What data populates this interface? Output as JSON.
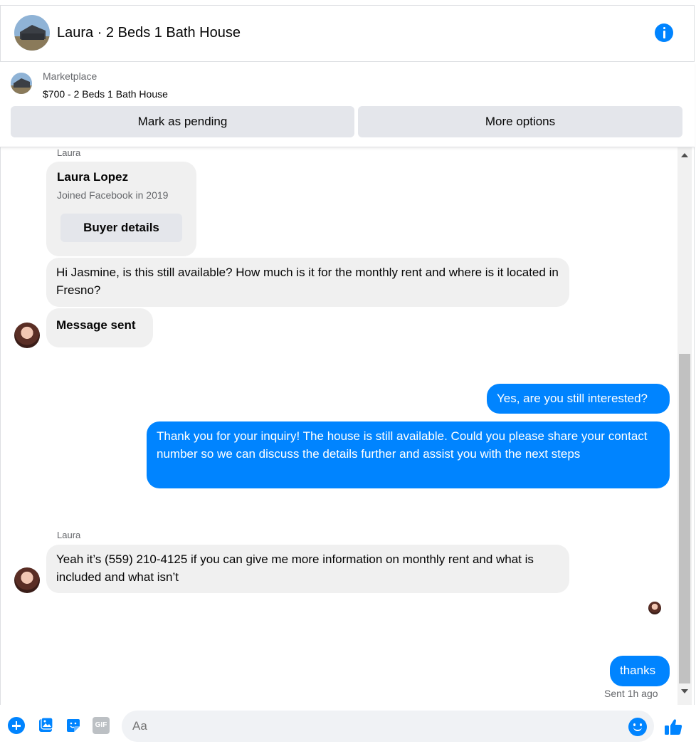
{
  "header": {
    "title": "Laura · 2 Beds 1 Bath House"
  },
  "marketplace": {
    "label": "Marketplace",
    "item": "$700 - 2 Beds 1 Bath House",
    "mark_pending_label": "Mark as pending",
    "more_options_label": "More options"
  },
  "chat": {
    "sender_name_1": "Laura",
    "profile_card": {
      "name": "Laura Lopez",
      "joined": "Joined Facebook in 2019",
      "button_label": "Buyer details"
    },
    "msg_in_1": "Hi Jasmine, is this still available? How much is it for the monthly rent and where is it located in Fresno?",
    "msg_in_2": "Message sent",
    "msg_out_1": "Yes, are you still interested?",
    "msg_out_2": "Thank you for your inquiry! The house is still available. Could you please share your contact number so we can discuss the details further and assist you with the next steps",
    "sender_name_2": "Laura",
    "msg_in_3": "Yeah it’s (559) 210-4125 if you can give me more information on monthly rent and what is included and what isn’t",
    "msg_out_3": "thanks",
    "sent_status": "Sent 1h ago"
  },
  "composer": {
    "placeholder": "Aa",
    "gif_label": "GIF"
  },
  "colors": {
    "accent": "#0084ff",
    "incoming_bubble": "#f0f0f0",
    "button_bg": "#e4e6eb"
  },
  "icons": [
    "info-icon",
    "plus-icon",
    "image-icon",
    "sticker-icon",
    "gif-icon",
    "emoji-icon",
    "like-icon"
  ]
}
